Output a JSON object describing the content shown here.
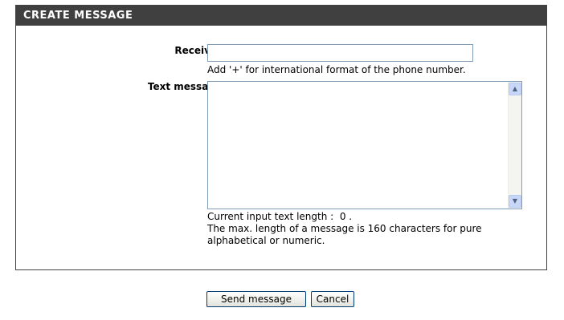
{
  "panel": {
    "title": "CREATE MESSAGE"
  },
  "form": {
    "receiver_label": "Receiver :",
    "receiver_value": "",
    "receiver_hint": "Add '+' for international format of the phone number.",
    "text_label": "Text message :",
    "text_value": "",
    "length_label": "Current input text length :",
    "length_value": "0 .",
    "max_note_line1": "The max. length of a message is 160 characters for pure",
    "max_note_line2": "alphabetical or numeric."
  },
  "buttons": {
    "send_label": "Send message",
    "cancel_label": "Cancel"
  },
  "icons": {
    "scroll_up": "chevron-up-icon",
    "scroll_down": "chevron-down-icon"
  },
  "colors": {
    "header_bg": "#404040",
    "header_text": "#ffffff",
    "input_border": "#7f9db9",
    "scroll_button": "#c8d6f8"
  }
}
